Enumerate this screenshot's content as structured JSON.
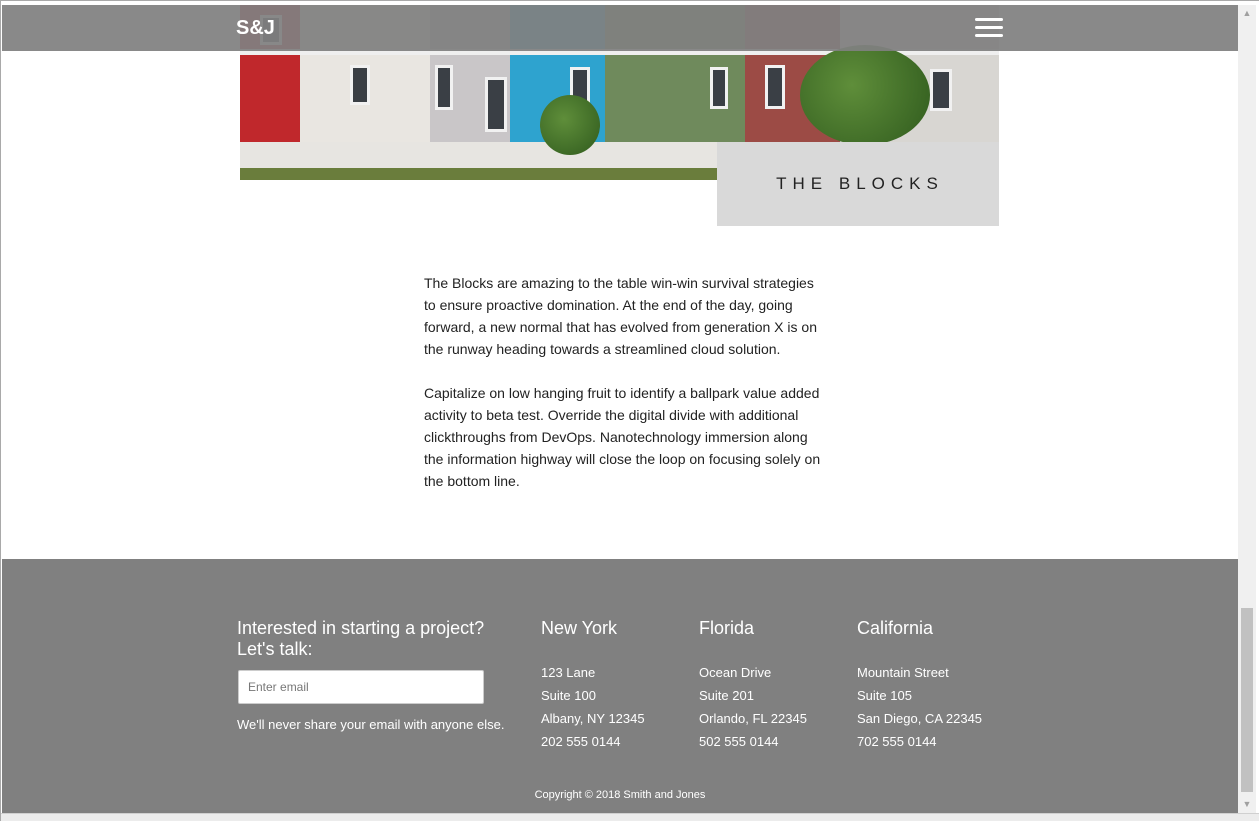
{
  "navbar": {
    "brand": "S&J",
    "menu_icon": "hamburger-menu-icon"
  },
  "hero": {
    "image_icon": "row-houses-photo",
    "title": "THE BLOCKS"
  },
  "article": {
    "paragraphs": [
      "The Blocks are amazing to the table win-win survival strategies to ensure proactive domination. At the end of the day, going forward, a new normal that has evolved from generation X is on the runway heading towards a streamlined cloud solution.",
      "Capitalize on low hanging fruit to identify a ballpark value added activity to beta test. Override the digital divide with additional clickthroughs from DevOps. Nanotechnology immersion along the information highway will close the loop on focusing solely on the bottom line."
    ]
  },
  "footer": {
    "cta_line1": "Interested in starting a project?",
    "cta_line2": "Let's talk:",
    "email_placeholder": "Enter email",
    "privacy_note": "We'll never share your email with anyone else.",
    "offices": [
      {
        "city": "New York",
        "street": "123 Lane",
        "suite": "Suite 100",
        "locality": "Albany, NY 12345",
        "phone": "202 555 0144"
      },
      {
        "city": "Florida",
        "street": "Ocean Drive",
        "suite": "Suite 201",
        "locality": "Orlando, FL 22345",
        "phone": "502 555 0144"
      },
      {
        "city": "California",
        "street": "Mountain Street",
        "suite": "Suite 105",
        "locality": "San Diego, CA 22345",
        "phone": "702 555 0144"
      }
    ],
    "copyright": "Copyright © 2018 Smith and Jones"
  },
  "colors": {
    "navbar_bg": "#808080",
    "footer_bg": "#808080",
    "title_box_bg": "#d9d9d9"
  }
}
